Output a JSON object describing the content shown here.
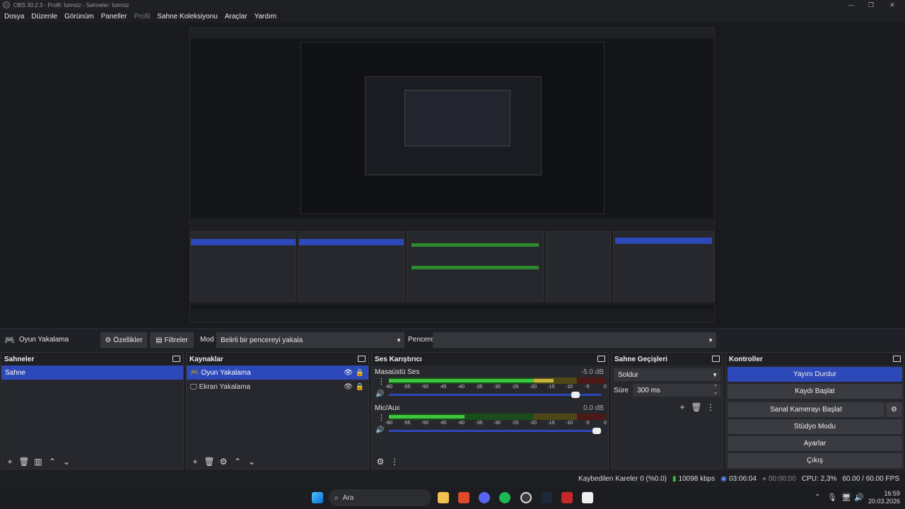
{
  "window": {
    "title": "OBS 30.2.3 - Profil: İsimsiz - Sahneler: İsimsiz"
  },
  "menu": [
    "Dosya",
    "Düzenle",
    "Görünüm",
    "Paneller",
    "Profil",
    "Sahne Koleksiyonu",
    "Araçlar",
    "Yardım"
  ],
  "source_bar": {
    "source_name": "Oyun Yakalama",
    "properties_label": "Özellikler",
    "filters_label": "Filtreler",
    "mode_label": "Mod",
    "mode_value": "Belirli bir pencereyi yakala",
    "window_label": "Pencere",
    "window_value": ""
  },
  "scenes": {
    "title": "Sahneler",
    "items": [
      "Sahne"
    ]
  },
  "sources": {
    "title": "Kaynaklar",
    "items": [
      "Oyun Yakalama",
      "Ekran Yakalama"
    ]
  },
  "mixer": {
    "title": "Ses Karıştırıcı",
    "channels": [
      {
        "name": "Masaüstü Ses",
        "db": "-5.0 dB",
        "level": 0.76,
        "volume": 0.9
      },
      {
        "name": "Mic/Aux",
        "db": "0.0 dB",
        "level": 0.35,
        "volume": 1.0
      }
    ],
    "scale": [
      "-60",
      "-55",
      "-50",
      "-45",
      "-40",
      "-35",
      "-30",
      "-25",
      "-20",
      "-15",
      "-10",
      "-5",
      "0"
    ]
  },
  "transitions": {
    "title": "Sahne Geçişleri",
    "transition": "Soldur",
    "duration_label": "Süre",
    "duration_value": "300 ms"
  },
  "controls": {
    "title": "Kontroller",
    "buttons": [
      "Yayını Durdur",
      "Kaydı Başlat",
      "Sanal Kamerayı Başlat",
      "Stüdyo Modu",
      "Ayarlar",
      "Çıkış"
    ]
  },
  "status": {
    "dropped": "Kaybedilen Kareler 0 (%0.0)",
    "bitrate": "10098 kbps",
    "stream_time": "03:06:04",
    "rec_time": "00:00:00",
    "cpu": "CPU: 2,3%",
    "fps": "60.00 / 60.00 FPS"
  },
  "taskbar": {
    "search_placeholder": "Ara",
    "time": "16:59",
    "date": "20.03.2026"
  }
}
